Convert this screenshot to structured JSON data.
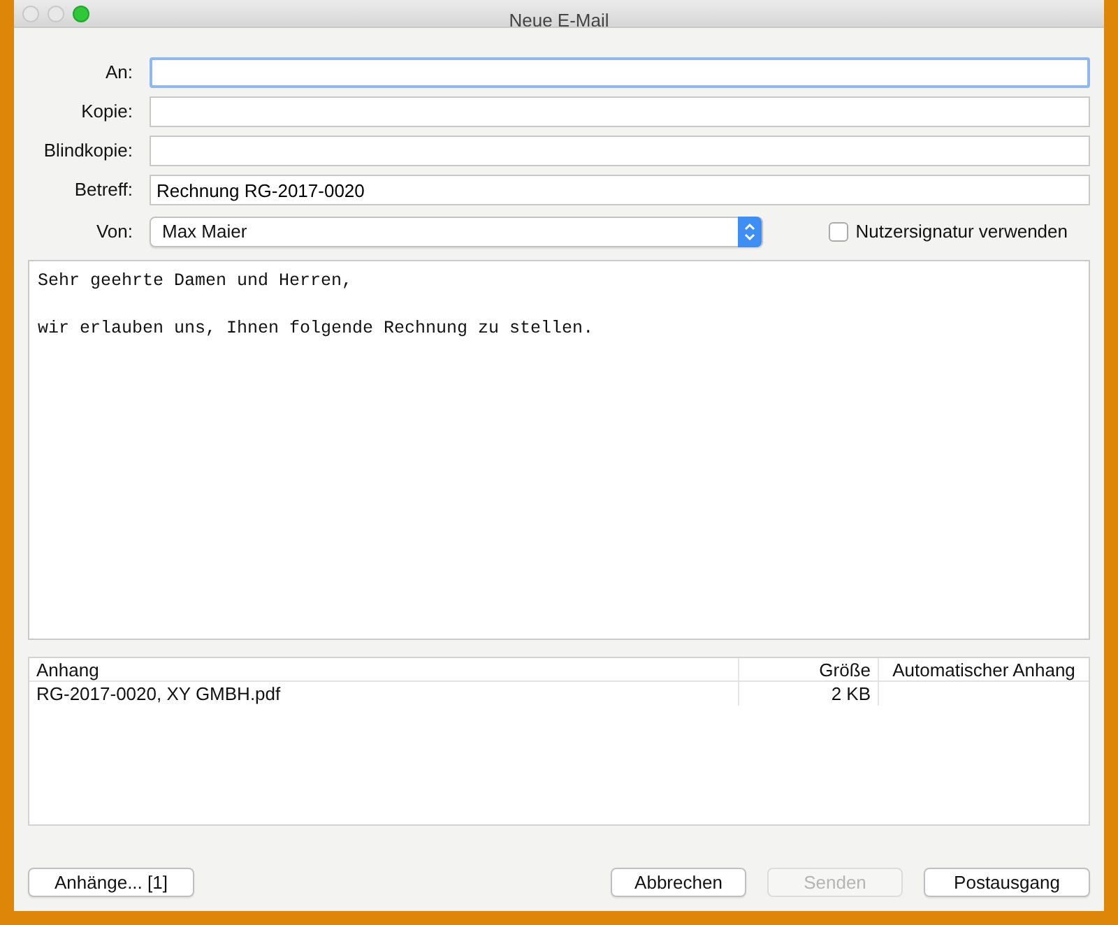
{
  "window": {
    "title": "Neue E-Mail"
  },
  "fields": [
    {
      "label": "An:",
      "focused": true
    },
    {
      "label": "Kopie:",
      "focused": false
    },
    {
      "label": "Blindkopie:",
      "focused": false
    },
    {
      "label": "Betreff:",
      "value": "Rechnung RG-2017-0020",
      "focused": false
    }
  ],
  "from": {
    "label": "Von:",
    "value": "Max Maier"
  },
  "signature": {
    "label": "Nutzersignatur verwenden",
    "checked": false
  },
  "body": "Sehr geehrte Damen und Herren,\n\nwir erlauben uns, Ihnen folgende Rechnung zu stellen.",
  "attachments": {
    "columns": [
      "Anhang",
      "Größe",
      "Automatischer Anhang"
    ],
    "rows": [
      [
        "RG-2017-0020, XY GMBH.pdf",
        "2 KB"
      ]
    ]
  },
  "left_buttons": [
    {
      "label": "Anhänge... [1]",
      "disabled": false
    }
  ],
  "right_buttons": [
    {
      "label": "Abbrechen",
      "disabled": false
    },
    {
      "label": "Senden",
      "disabled": true
    },
    {
      "label": "Postausgang",
      "disabled": false
    }
  ]
}
